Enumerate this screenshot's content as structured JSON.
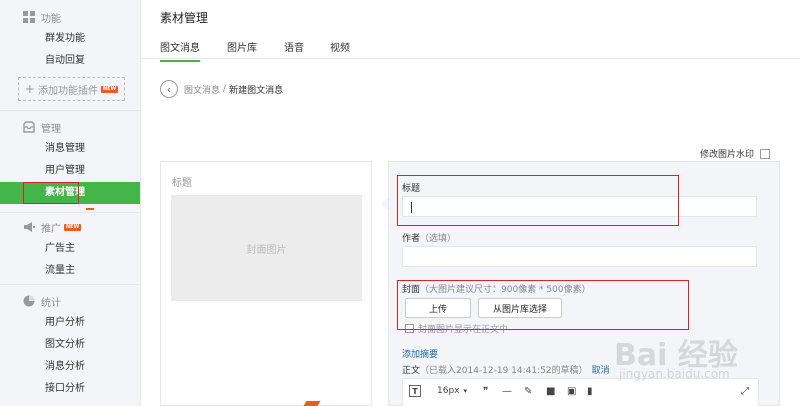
{
  "sidebar": {
    "func_head": "功能",
    "func_items": [
      "群发功能",
      "自动回复"
    ],
    "add_plugin": "添加功能插件",
    "new_badge": "NEW",
    "manage_head": "管理",
    "manage_items": [
      "消息管理",
      "用户管理",
      "素材管理"
    ],
    "promo_head": "推广",
    "promo_items": [
      "广告主",
      "流量主"
    ],
    "stats_head": "统计",
    "stats_items": [
      "用户分析",
      "图文分析",
      "消息分析",
      "接口分析"
    ]
  },
  "header": {
    "title": "素材管理",
    "tabs": [
      "图文消息",
      "图片库",
      "语音",
      "视频"
    ]
  },
  "breadcrumb": {
    "parent": "图文消息",
    "separator": "/",
    "current": "新建图文消息"
  },
  "watermark_option": "修改图片水印",
  "preview": {
    "title_placeholder": "标题",
    "cover_placeholder": "封面图片"
  },
  "editor": {
    "title_label": "标题",
    "title_value": "",
    "author_label": "作者",
    "author_hint": "（选填）",
    "cover_label": "封面",
    "cover_hint": "（大图片建议尺寸：900像素 * 500像素）",
    "upload_button": "上传",
    "library_button": "从图片库选择",
    "show_cover_in_body": "封面图片显示在正文中",
    "add_summary": "添加摘要",
    "body_label": "正文",
    "draft_info": "（已载入2014-12-19 14:41:52的草稿）",
    "cancel_link": "取消",
    "toolbar": {
      "text_btn": "T",
      "font_size": "16px",
      "dropdown": "▾",
      "quote": "❞",
      "hr": "—",
      "brush": "✎",
      "video": "■",
      "image": "▣",
      "chart": "▮",
      "fullscreen": "⤢"
    }
  },
  "watermark": {
    "brand": "Bai 经验",
    "url": "jingyan.baidu.com"
  },
  "colors": {
    "accent_green": "#44b549",
    "highlight_red": "#d9222a",
    "link_blue": "#1e6ea9",
    "sidebar_bg": "#f4f5f9"
  }
}
